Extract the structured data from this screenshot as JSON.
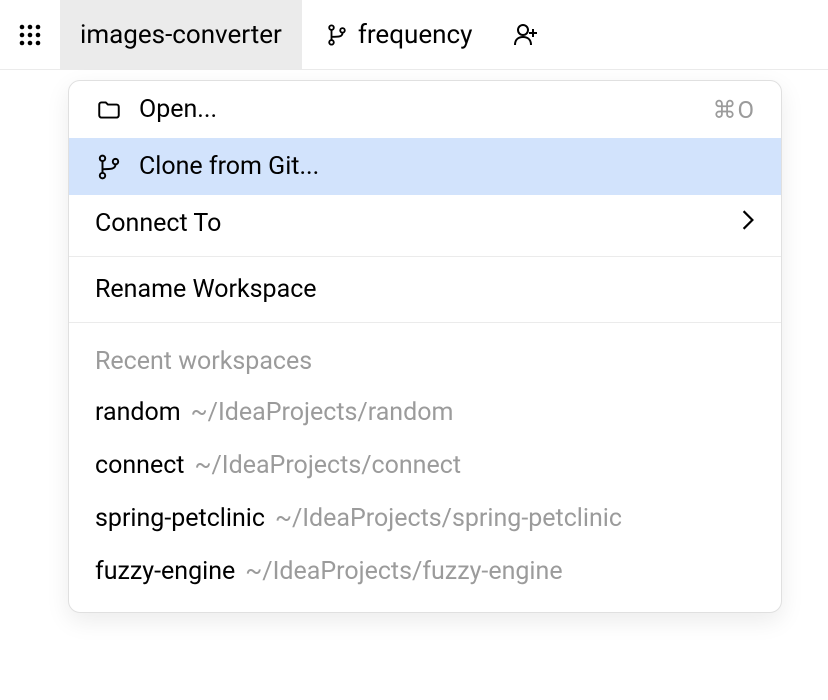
{
  "toolbar": {
    "tabs": [
      {
        "label": "images-converter",
        "active": true,
        "hasGitIcon": false
      },
      {
        "label": "frequency",
        "active": false,
        "hasGitIcon": true
      }
    ]
  },
  "menu": {
    "open": {
      "label": "Open...",
      "shortcut": "⌘O"
    },
    "clone": {
      "label": "Clone from Git..."
    },
    "connect": {
      "label": "Connect To"
    },
    "rename": {
      "label": "Rename Workspace"
    },
    "recentHeader": "Recent workspaces",
    "recent": [
      {
        "name": "random",
        "path": "~/IdeaProjects/random"
      },
      {
        "name": "connect",
        "path": "~/IdeaProjects/connect"
      },
      {
        "name": "spring-petclinic",
        "path": "~/IdeaProjects/spring-petclinic"
      },
      {
        "name": "fuzzy-engine",
        "path": "~/IdeaProjects/fuzzy-engine"
      }
    ]
  }
}
